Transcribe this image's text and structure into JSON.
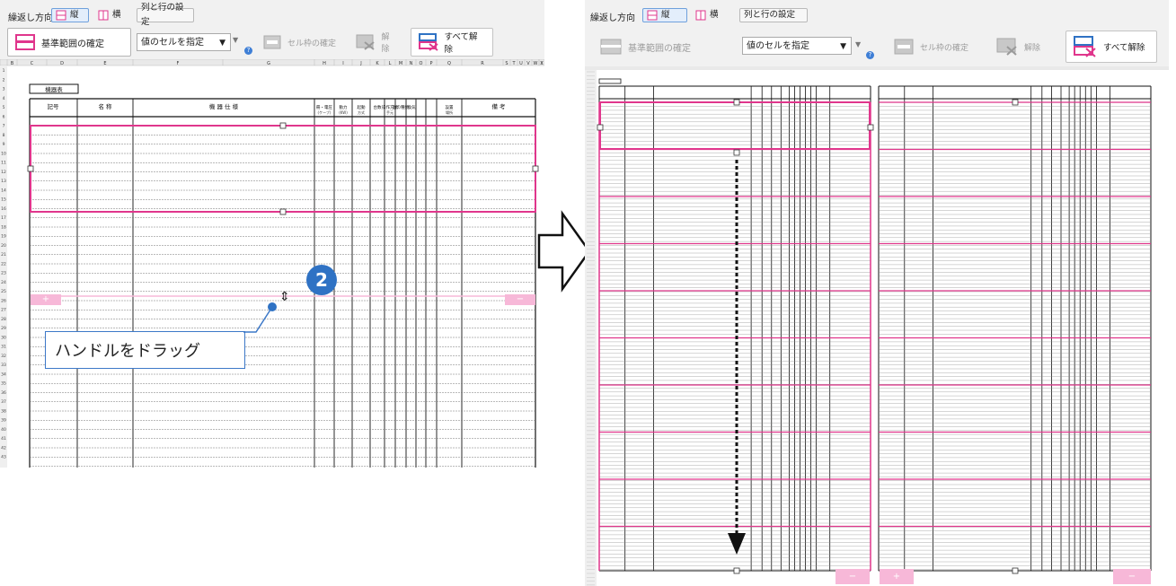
{
  "left_panel": {
    "toolbar": {
      "repeat_direction_label": "繰返し方向",
      "vertical_label": "縦",
      "horizontal_label": "横",
      "col_row_settings_label": "列と行の設定",
      "confirm_base_range_label": "基準範囲の確定",
      "cell_value_select": "値のセルを指定",
      "confirm_cell_frame_label": "セル枠の確定",
      "clear_label": "解除",
      "clear_all_label": "すべて解除"
    },
    "sheet": {
      "table_title": "機器表",
      "column_letters": [
        "B",
        "C",
        "D",
        "E",
        "F",
        "G",
        "H",
        "I",
        "J",
        "K",
        "L",
        "M",
        "N",
        "O",
        "P",
        "Q",
        "R",
        "S",
        "T",
        "U",
        "V",
        "W",
        "X",
        "Y"
      ],
      "header_cells": [
        "記号",
        "名 称",
        "機 器 仕 様",
        "冊・電圧",
        "動力",
        "起動",
        "台数",
        "操作方式",
        "盤の種類",
        "換気",
        "設置",
        "備 考"
      ],
      "header_subtexts": [
        "(ケーブ)",
        "(KW)",
        "方式",
        "手元",
        "場所"
      ],
      "row_numbers": [
        "1",
        "2",
        "3",
        "4",
        "5",
        "6",
        "7",
        "8",
        "9",
        "10",
        "11",
        "12",
        "13",
        "14",
        "15",
        "16",
        "17",
        "18",
        "19",
        "20",
        "21",
        "22",
        "23",
        "24",
        "25",
        "26",
        "27",
        "28",
        "29",
        "30",
        "31",
        "32",
        "33",
        "34",
        "35",
        "36",
        "37",
        "38",
        "39",
        "40",
        "41",
        "42",
        "43"
      ],
      "plus_tab": "+",
      "minus_tab": "−"
    },
    "step_badge": "2",
    "callout_text": "ハンドルをドラッグ"
  },
  "right_panel": {
    "toolbar": {
      "repeat_direction_label": "繰返し方向",
      "vertical_label": "縦",
      "horizontal_label": "横",
      "col_row_settings_label": "列と行の設定",
      "confirm_base_range_label": "基準範囲の確定",
      "cell_value_select": "値のセルを指定",
      "confirm_cell_frame_label": "セル枠の確定",
      "clear_label": "解除",
      "clear_all_label": "すべて解除"
    },
    "sheet": {
      "plus_tab": "+",
      "minus_tab": "−"
    }
  },
  "colors": {
    "accent_pink": "#e0368c",
    "light_pink": "#f7b8d8",
    "blue": "#2f72c4",
    "grid": "#9a9a9a"
  }
}
